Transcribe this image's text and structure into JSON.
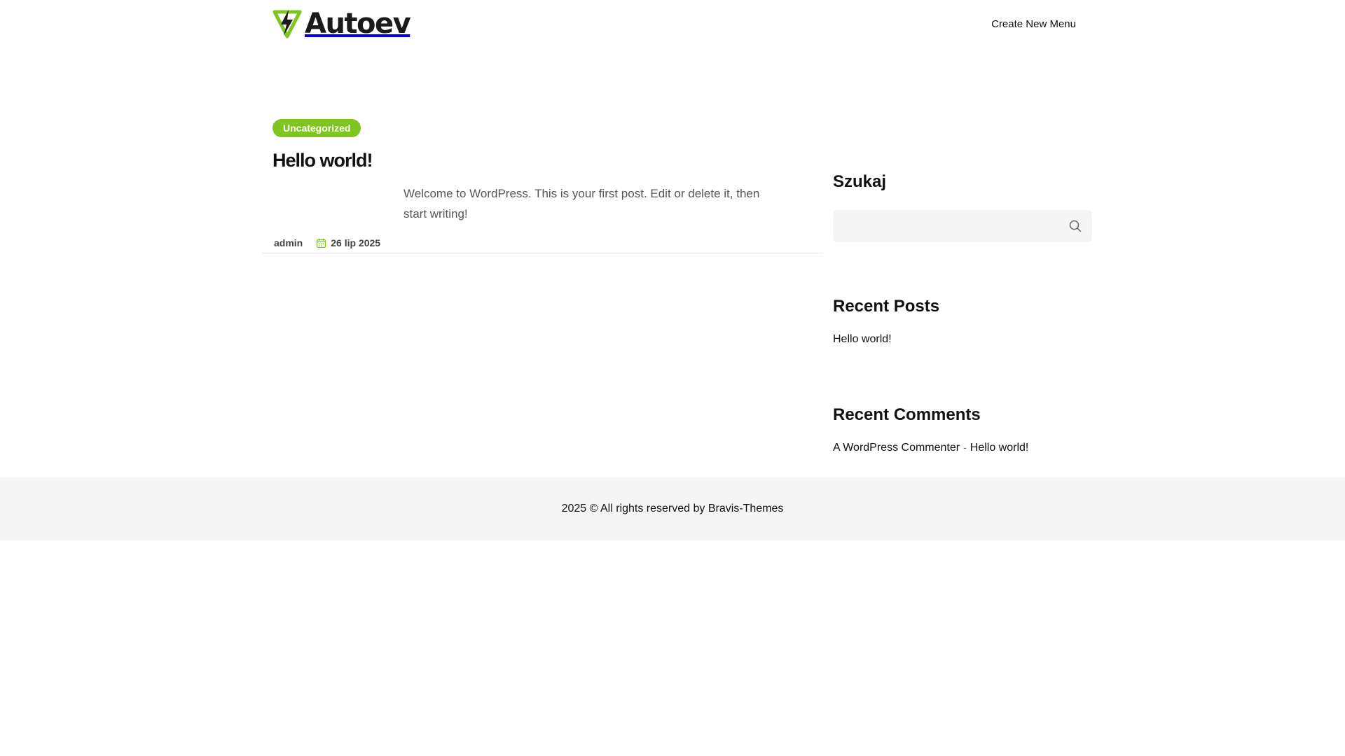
{
  "header": {
    "logo_text": "Autoev",
    "menu_link": "Create New Menu"
  },
  "post": {
    "category": "Uncategorized",
    "title": "Hello world!",
    "excerpt": "Welcome to WordPress. This is your first post. Edit or delete it, then start writing!",
    "author": "admin",
    "date": "26 lip 2025"
  },
  "sidebar": {
    "search_title": "Szukaj",
    "search_placeholder": "",
    "recent_posts_title": "Recent Posts",
    "recent_posts": [
      "Hello world!"
    ],
    "recent_comments_title": "Recent Comments",
    "recent_comments": [
      {
        "author": "A WordPress Commenter",
        "separator": "-",
        "post": "Hello world!"
      }
    ]
  },
  "footer": {
    "copyright": "2025 © All rights reserved by Bravis-Themes"
  },
  "colors": {
    "accent": "#7ec51f",
    "footer_bg": "#f4f5f4",
    "search_bg": "#f4f5f4"
  },
  "icons": {
    "logo": "lightning-bolt-icon",
    "date": "calendar-icon",
    "search": "search-icon"
  }
}
